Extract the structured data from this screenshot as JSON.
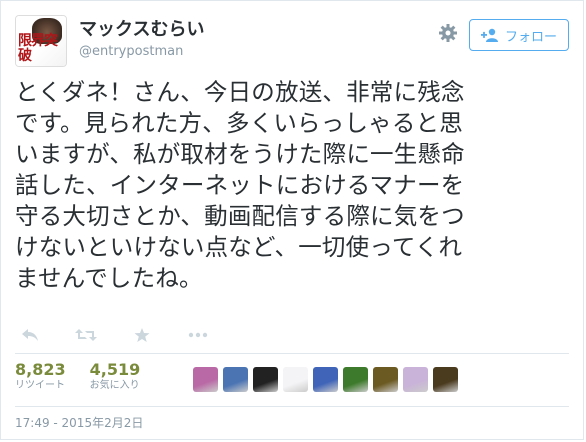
{
  "user": {
    "display_name": "マックスむらい",
    "screen_name": "@entrypostman",
    "avatar_text": "限界突破"
  },
  "follow_button": {
    "label": "フォロー",
    "icon": "add-user-icon"
  },
  "settings_icon": "gear-icon",
  "tweet": {
    "lines": [
      "とくダネ！さん、今日の放送、非常に残念",
      "です。見られた方、多くいらっしゃると思",
      "いますが、私が取材をうけた際に一生懸命",
      "話した、インターネットにおけるマナーを",
      "守る大切さとか、動画配信する際に気をつ",
      "けないといけない点など、一切使ってくれ",
      "ませんでしたね。"
    ]
  },
  "actions": [
    {
      "name": "reply-icon"
    },
    {
      "name": "retweet-icon"
    },
    {
      "name": "favorite-icon"
    },
    {
      "name": "more-icon"
    }
  ],
  "stats": {
    "retweets": {
      "count": "8,823",
      "label": "リツイート"
    },
    "favorites": {
      "count": "4,519",
      "label": "お気に入り"
    }
  },
  "favoriters": [
    {
      "name": "favoriter-avatar-1",
      "color": "#b96aa6"
    },
    {
      "name": "favoriter-avatar-2",
      "color": "#4b74b3"
    },
    {
      "name": "favoriter-avatar-3",
      "color": "#222222"
    },
    {
      "name": "favoriter-avatar-4",
      "color": "#f4f4f6"
    },
    {
      "name": "favoriter-avatar-5",
      "color": "#3f64b8"
    },
    {
      "name": "favoriter-avatar-6",
      "color": "#3d7a2b"
    },
    {
      "name": "favoriter-avatar-7",
      "color": "#6b5a22"
    },
    {
      "name": "favoriter-avatar-8",
      "color": "#c9b3d8"
    },
    {
      "name": "favoriter-avatar-9",
      "color": "#4a3a1e"
    }
  ],
  "timestamp": "17:49 - 2015年2月2日",
  "colors": {
    "accent": "#55acee",
    "count": "#7a8b3c",
    "muted": "#8899a6",
    "text": "#292f33"
  }
}
